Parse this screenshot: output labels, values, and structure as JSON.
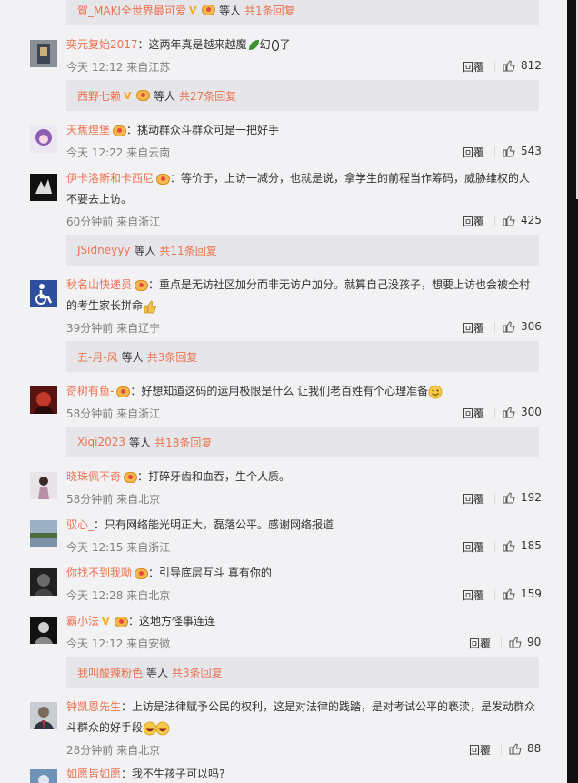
{
  "reply_label": "回覆",
  "more_groups": [
    {
      "user": "賀_MAKI全世界最可爱",
      "suffix": "等人",
      "count": "共1条回复"
    },
    {
      "user": "西野七赖",
      "suffix": "等人",
      "count": "共27条回复"
    },
    {
      "user": "JSidneyyy",
      "suffix": "等人",
      "count": "共11条回复"
    },
    {
      "user": "五-月-风",
      "suffix": "等人",
      "count": "共3条回复"
    },
    {
      "user": "Xiqi2023",
      "suffix": "等人",
      "count": "共18条回复"
    },
    {
      "user": "我叫酸辣粉色",
      "suffix": "等人",
      "count": "共3条回复"
    }
  ],
  "comments": [
    {
      "name": "奕元复始2017",
      "text": "：这两年真是越来越魔",
      "text_tail": "幻",
      "text_end": "了",
      "time": "今天 12:12 来自江苏",
      "likes": "812"
    },
    {
      "name": "天蕉煌堡",
      "text": "：挑动群众斗群众可是一把好手",
      "time": "今天 12:22 来自云南",
      "likes": "543"
    },
    {
      "name": "伊卡洛斯和卡西尼",
      "text": "：等价于，上访一减分，也就是说，拿学生的前程当作筹码，威胁维权的人不要去上访。",
      "time": "60分钟前 来自浙江",
      "likes": "425"
    },
    {
      "name": "秋名山快递员",
      "text": "：重点是无访社区加分而非无访户加分。就算自己没孩子，想要上访也会被全村的考生家长拼命",
      "time": "39分钟前 来自辽宁",
      "likes": "306"
    },
    {
      "name": "奇树有鱼-",
      "text": "：好想知道这码的运用极限是什么 让我们老百姓有个心理准备",
      "time": "58分钟前 来自浙江",
      "likes": "300"
    },
    {
      "name": "晓珠佩不奇",
      "text": "：打碎牙齿和血吞，生个人质。",
      "time": "58分钟前 来自北京",
      "likes": "192"
    },
    {
      "name": "驭心_",
      "text": "：只有网络能光明正大，磊落公平。感谢网络报道",
      "time": "今天 12:15 来自浙江",
      "likes": "185"
    },
    {
      "name": "你找不到我呦",
      "text": "：引导底层互斗 真有你的",
      "time": "今天 12:28 来自北京",
      "likes": "159"
    },
    {
      "name": "霸小法",
      "text": "：这地方怪事连连",
      "time": "今天 12:12 来自安徽",
      "likes": "90"
    },
    {
      "name": "钟凯恩先生",
      "text": "：上访是法律赋予公民的权利，这是对法律的践踏，是对考试公平的亵渎，是发动群众斗群众的好手段",
      "time": "28分钟前 来自北京",
      "likes": "88"
    },
    {
      "name": "如愿皆如愿",
      "text": "：我不生孩子可以吗?",
      "time": "",
      "likes": ""
    }
  ],
  "colors": {
    "accent": "#eb7350",
    "meta": "#808080",
    "panel": "#f2f2f5",
    "more_bg": "#e6e6ea"
  }
}
